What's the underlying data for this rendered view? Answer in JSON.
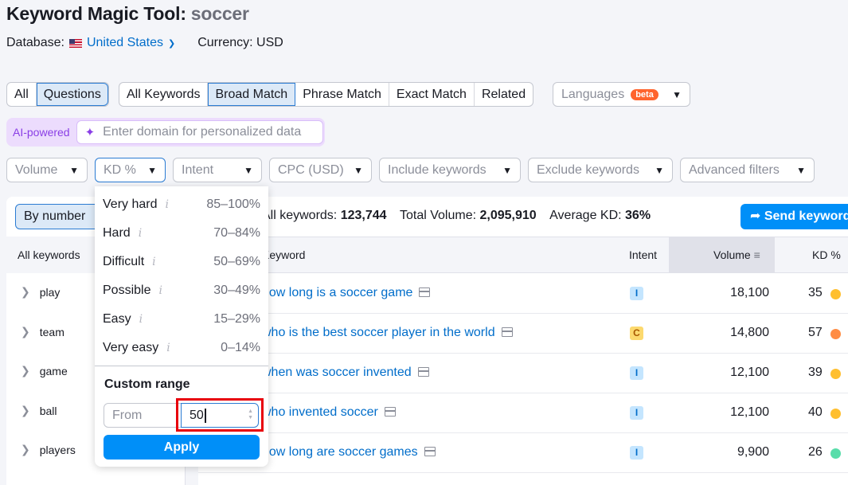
{
  "header": {
    "title": "Keyword Magic Tool:",
    "query": "soccer",
    "database_label": "Database:",
    "database_value": "United States",
    "currency": "Currency: USD"
  },
  "question_toggle": [
    "All",
    "Questions"
  ],
  "question_toggle_active": "Questions",
  "match_tabs": [
    "All Keywords",
    "Broad Match",
    "Phrase Match",
    "Exact Match",
    "Related"
  ],
  "match_tabs_active": "Broad Match",
  "languages": {
    "label": "Languages",
    "badge": "beta"
  },
  "ai": {
    "label": "AI-powered",
    "placeholder": "Enter domain for personalized data"
  },
  "filters": [
    "Volume",
    "KD %",
    "Intent",
    "CPC (USD)",
    "Include keywords",
    "Exclude keywords",
    "Advanced filters"
  ],
  "filters_open": "KD %",
  "left_panel": {
    "view_button": "By number",
    "all_keywords": "All keywords",
    "groups": [
      "play",
      "team",
      "game",
      "ball",
      "players"
    ]
  },
  "stats": {
    "keywords_label": "All keywords:",
    "keywords_value": "123,744",
    "volume_label": "Total Volume:",
    "volume_value": "2,095,910",
    "kd_label": "Average KD:",
    "kd_value": "36%"
  },
  "send_button": "Send keywords",
  "table": {
    "headers": {
      "keyword": "Keyword",
      "intent": "Intent",
      "volume": "Volume",
      "kd": "KD %"
    },
    "rows": [
      {
        "keyword": "how long is a soccer game",
        "intent": "I",
        "volume": "18,100",
        "kd": "35",
        "kd_color": "#ffbf2f"
      },
      {
        "keyword": "who is the best soccer player in the world",
        "intent": "C",
        "volume": "14,800",
        "kd": "57",
        "kd_color": "#ff8c43"
      },
      {
        "keyword": "when was soccer invented",
        "intent": "I",
        "volume": "12,100",
        "kd": "39",
        "kd_color": "#ffbf2f"
      },
      {
        "keyword": "who invented soccer",
        "intent": "I",
        "volume": "12,100",
        "kd": "40",
        "kd_color": "#ffbf2f"
      },
      {
        "keyword": "how long are soccer games",
        "intent": "I",
        "volume": "9,900",
        "kd": "26",
        "kd_color": "#59ddaa"
      }
    ]
  },
  "kd_menu": {
    "items": [
      {
        "label": "Very hard",
        "range": "85–100%"
      },
      {
        "label": "Hard",
        "range": "70–84%"
      },
      {
        "label": "Difficult",
        "range": "50–69%"
      },
      {
        "label": "Possible",
        "range": "30–49%"
      },
      {
        "label": "Easy",
        "range": "15–29%"
      },
      {
        "label": "Very easy",
        "range": "0–14%"
      }
    ],
    "custom_range_label": "Custom range",
    "from_placeholder": "From",
    "to_value": "50",
    "apply_label": "Apply"
  },
  "colors": {
    "accent": "#008ff8",
    "link": "#006dca",
    "highlight": "#e8000b"
  }
}
